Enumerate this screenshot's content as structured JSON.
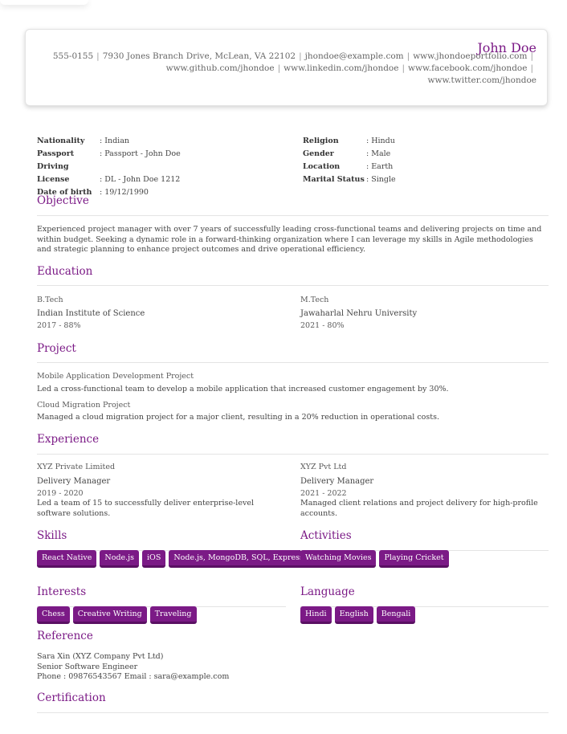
{
  "header": {
    "name": "John Doe",
    "contact_line1": [
      "555-0155",
      "7930 Jones Branch Drive, McLean, VA 22102",
      "jhondoe@example.com",
      "www.jhondoeportfolio.com"
    ],
    "contact_line2": [
      "www.github.com/jhondoe",
      "www.linkedin.com/jhondoe",
      "www.facebook.com/jhondoe"
    ],
    "contact_line3": "www.twitter.com/jhondoe"
  },
  "personal": {
    "left": [
      {
        "label": "Nationality",
        "value": ": Indian"
      },
      {
        "label": "Passport",
        "value": ": Passport - John Doe"
      },
      {
        "label": "Driving License",
        "value": ": DL - John Doe 1212"
      },
      {
        "label": "Date of birth",
        "value": ": 19/12/1990"
      }
    ],
    "right": [
      {
        "label": "Religion",
        "value": ": Hindu"
      },
      {
        "label": "Gender",
        "value": ": Male"
      },
      {
        "label": "Location",
        "value": ": Earth"
      },
      {
        "label": "Marital Status",
        "value": ": Single"
      }
    ]
  },
  "objective": {
    "title": "Objective",
    "text": "Experienced project manager with over 7 years of successfully leading cross-functional teams and delivering projects on time and within budget. Seeking a dynamic role in a forward-thinking organization where I can leverage my skills in Agile methodologies and strategic planning to enhance project outcomes and drive operational efficiency."
  },
  "education": {
    "title": "Education",
    "items": [
      {
        "degree": "B.Tech",
        "school": "Indian Institute of Science",
        "meta": "2017 - 88%"
      },
      {
        "degree": "M.Tech",
        "school": "Jawaharlal Nehru University",
        "meta": "2021 - 80%"
      }
    ]
  },
  "project": {
    "title": "Project",
    "items": [
      {
        "name": "Mobile Application Development Project",
        "desc": "Led a cross-functional team to develop a mobile application that increased customer engagement by 30%."
      },
      {
        "name": "Cloud Migration Project",
        "desc": "Managed a cloud migration project for a major client, resulting in a 20% reduction in operational costs."
      }
    ]
  },
  "experience": {
    "title": "Experience",
    "items": [
      {
        "company": "XYZ Private Limited",
        "role": "Delivery Manager",
        "years": "2019 - 2020",
        "desc": "Led a team of 15 to successfully deliver enterprise-level software solutions."
      },
      {
        "company": "XYZ Pvt Ltd",
        "role": "Delivery Manager",
        "years": "2021 - 2022",
        "desc": "Managed client relations and project delivery for high-profile accounts."
      }
    ]
  },
  "skills": {
    "title": "Skills",
    "tags": [
      "React Native",
      "Node.js",
      "iOS",
      "Node.js, MongoDB, SQL, Express"
    ]
  },
  "activities": {
    "title": "Activities",
    "tags": [
      "Watching Movies",
      "Playing Cricket"
    ]
  },
  "interests": {
    "title": "Interests",
    "tags": [
      "Chess",
      "Creative Writing",
      "Traveling"
    ]
  },
  "language": {
    "title": "Language",
    "tags": [
      "Hindi",
      "English",
      "Bengali"
    ]
  },
  "reference": {
    "title": "Reference",
    "name": "Sara Xin (XYZ Company Pvt Ltd)",
    "position": "Senior Software Engineer",
    "contact": "Phone : 09876543567 Email : sara@example.com"
  },
  "certification": {
    "title": "Certification"
  },
  "colors": {
    "accent": "#7b1a86",
    "accent_dark": "#5a1063"
  }
}
